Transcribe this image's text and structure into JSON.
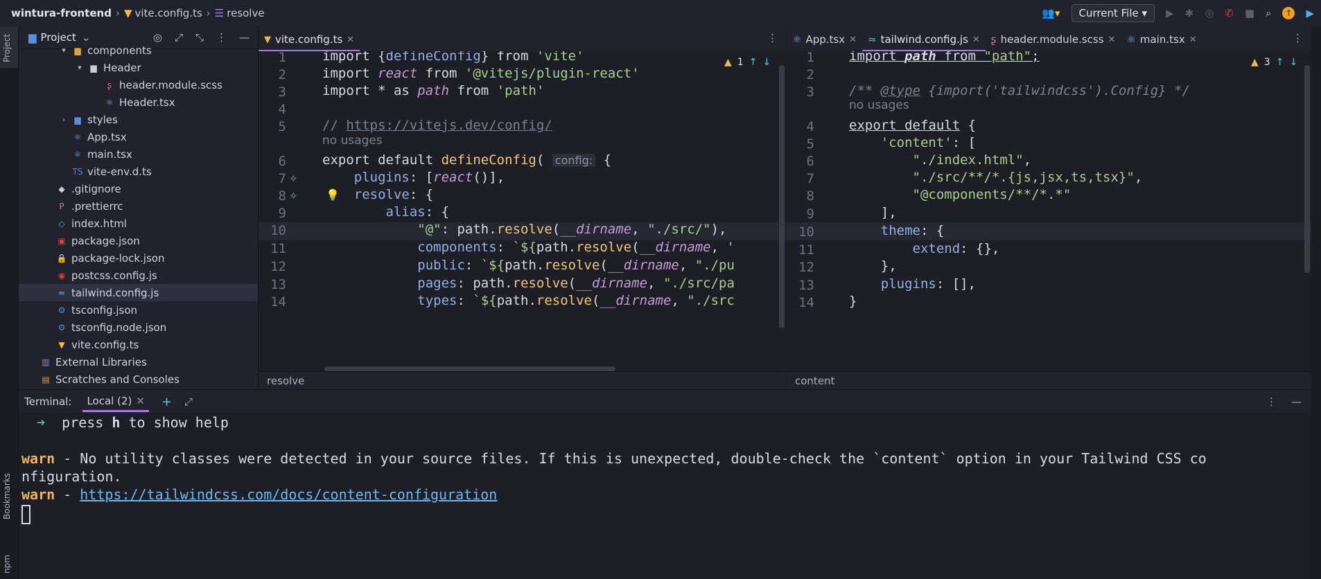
{
  "topbar": {
    "project": "wintura-frontend",
    "file": "vite.config.ts",
    "symbol": "resolve",
    "run_config": "Current File"
  },
  "left_strip": {
    "project": "Project",
    "bookmarks": "Bookmarks",
    "npm": "npm"
  },
  "project_panel": {
    "title": "Project",
    "items": [
      {
        "label": "components",
        "depth": 2,
        "kind": "folder-open",
        "icon_color": "#e0a040"
      },
      {
        "label": "Header",
        "depth": 3,
        "kind": "folder-open",
        "icon_color": "#c9ccd6"
      },
      {
        "label": "header.module.scss",
        "depth": 4,
        "kind": "scss",
        "icon_color": "#d96fa6"
      },
      {
        "label": "Header.tsx",
        "depth": 4,
        "kind": "react",
        "icon_color": "#5fb6e8"
      },
      {
        "label": "styles",
        "depth": 2,
        "kind": "folder-closed",
        "icon_color": "#5a8de0"
      },
      {
        "label": "App.tsx",
        "depth": 2,
        "kind": "react",
        "icon_color": "#5fb6e8"
      },
      {
        "label": "main.tsx",
        "depth": 2,
        "kind": "react",
        "icon_color": "#5fb6e8"
      },
      {
        "label": "vite-env.d.ts",
        "depth": 2,
        "kind": "ts",
        "icon_color": "#4b8ee0"
      },
      {
        "label": ".gitignore",
        "depth": 1,
        "kind": "git",
        "icon_color": "#c9ccd6"
      },
      {
        "label": ".prettierrc",
        "depth": 1,
        "kind": "prettier",
        "icon_color": "#d96fa6"
      },
      {
        "label": "index.html",
        "depth": 1,
        "kind": "html",
        "icon_color": "#4fb0e8"
      },
      {
        "label": "package.json",
        "depth": 1,
        "kind": "npm",
        "icon_color": "#d0424a"
      },
      {
        "label": "package-lock.json",
        "depth": 1,
        "kind": "lock",
        "icon_color": "#d0424a"
      },
      {
        "label": "postcss.config.js",
        "depth": 1,
        "kind": "postcss",
        "icon_color": "#d0424a"
      },
      {
        "label": "tailwind.config.js",
        "depth": 1,
        "kind": "tailwind",
        "icon_color": "#5fc1d8",
        "selected": true
      },
      {
        "label": "tsconfig.json",
        "depth": 1,
        "kind": "tsconfig",
        "icon_color": "#4b8ee0"
      },
      {
        "label": "tsconfig.node.json",
        "depth": 1,
        "kind": "tsconfig",
        "icon_color": "#4b8ee0"
      },
      {
        "label": "vite.config.ts",
        "depth": 1,
        "kind": "vite",
        "icon_color": "#f0c040"
      },
      {
        "label": "External Libraries",
        "depth": 0,
        "kind": "library",
        "icon_color": "#a67fdc"
      },
      {
        "label": "Scratches and Consoles",
        "depth": 0,
        "kind": "scratch",
        "icon_color": "#e0a040"
      }
    ]
  },
  "left_editor": {
    "tab": "vite.config.ts",
    "warnings": "1",
    "breadcrumb": "resolve",
    "no_usages": "no usages",
    "inlay": "config:",
    "line_numbers": [
      "1",
      "2",
      "3",
      "4",
      "5",
      "6",
      "7",
      "8",
      "9",
      "10",
      "11",
      "12",
      "13",
      "14"
    ]
  },
  "right_editor": {
    "tabs": [
      "App.tsx",
      "tailwind.config.js",
      "header.module.scss",
      "main.tsx"
    ],
    "active_tab": "tailwind.config.js",
    "warnings": "3",
    "breadcrumb": "content",
    "no_usages": "no usages",
    "line_numbers": [
      "1",
      "2",
      "3",
      "4",
      "5",
      "6",
      "7",
      "8",
      "9",
      "10",
      "11",
      "12",
      "13",
      "14"
    ]
  },
  "terminal": {
    "label": "Terminal:",
    "tab": "Local (2)",
    "line1_arrow": "➜",
    "line1_text": "  press ",
    "line1_key": "h",
    "line1_rest": " to show help",
    "warn_word": "warn",
    "warn1_text": " - No utility classes were detected in your source files. If this is unexpected, double-check the `content` option in your Tailwind CSS co",
    "warn1_cont": "nfiguration.",
    "warn2_dash": " - ",
    "warn2_link": "https://tailwindcss.com/docs/content-configuration"
  },
  "colors": {
    "accent": "#a67fdc",
    "warn": "#f0b45a",
    "link": "#6fb7ef",
    "string": "#a8d08d"
  }
}
